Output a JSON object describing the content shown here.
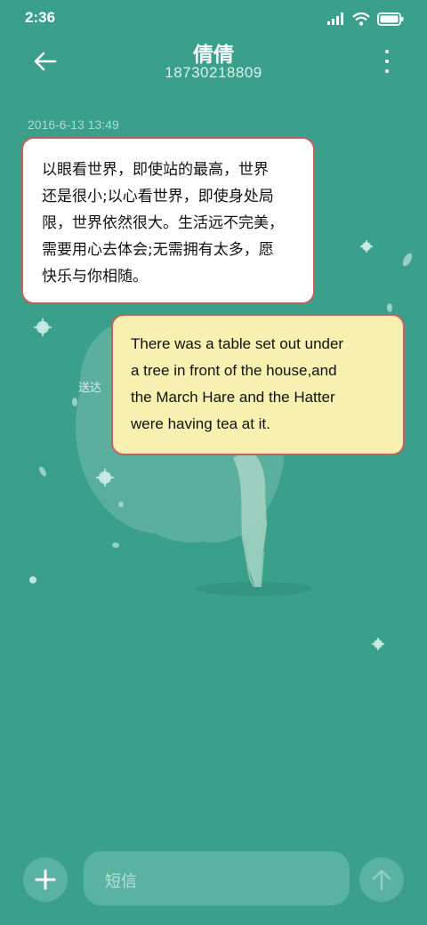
{
  "status_bar": {
    "time": "2:36",
    "icons": [
      "signal-icon",
      "wifi-icon",
      "battery-icon"
    ]
  },
  "header": {
    "contact_name": "倩倩",
    "phone_number": "18730218809"
  },
  "conversation": {
    "timestamp": "2016-6-13 13:49",
    "messages": [
      {
        "lines": [
          "以眼看世界，即使站的最高，世界",
          "还是很小;以心看世界，即使身处局",
          "限，世界依然很大。生活远不完美，",
          "需要用心去体会;无需拥有太多，愿",
          "快乐与你相随。"
        ]
      },
      {
        "lines": [
          "There was a table set out under",
          "a tree in front of the house,and",
          "the March Hare and the Hatter",
          "were having tea at it."
        ]
      }
    ],
    "delivery_status": "送达"
  },
  "composer": {
    "placeholder": "短信"
  },
  "colors": {
    "background": "#3aa08c",
    "bubble_border": "#c2605f",
    "sent_bubble": "#f8f0b0",
    "received_bubble": "#ffffff"
  }
}
